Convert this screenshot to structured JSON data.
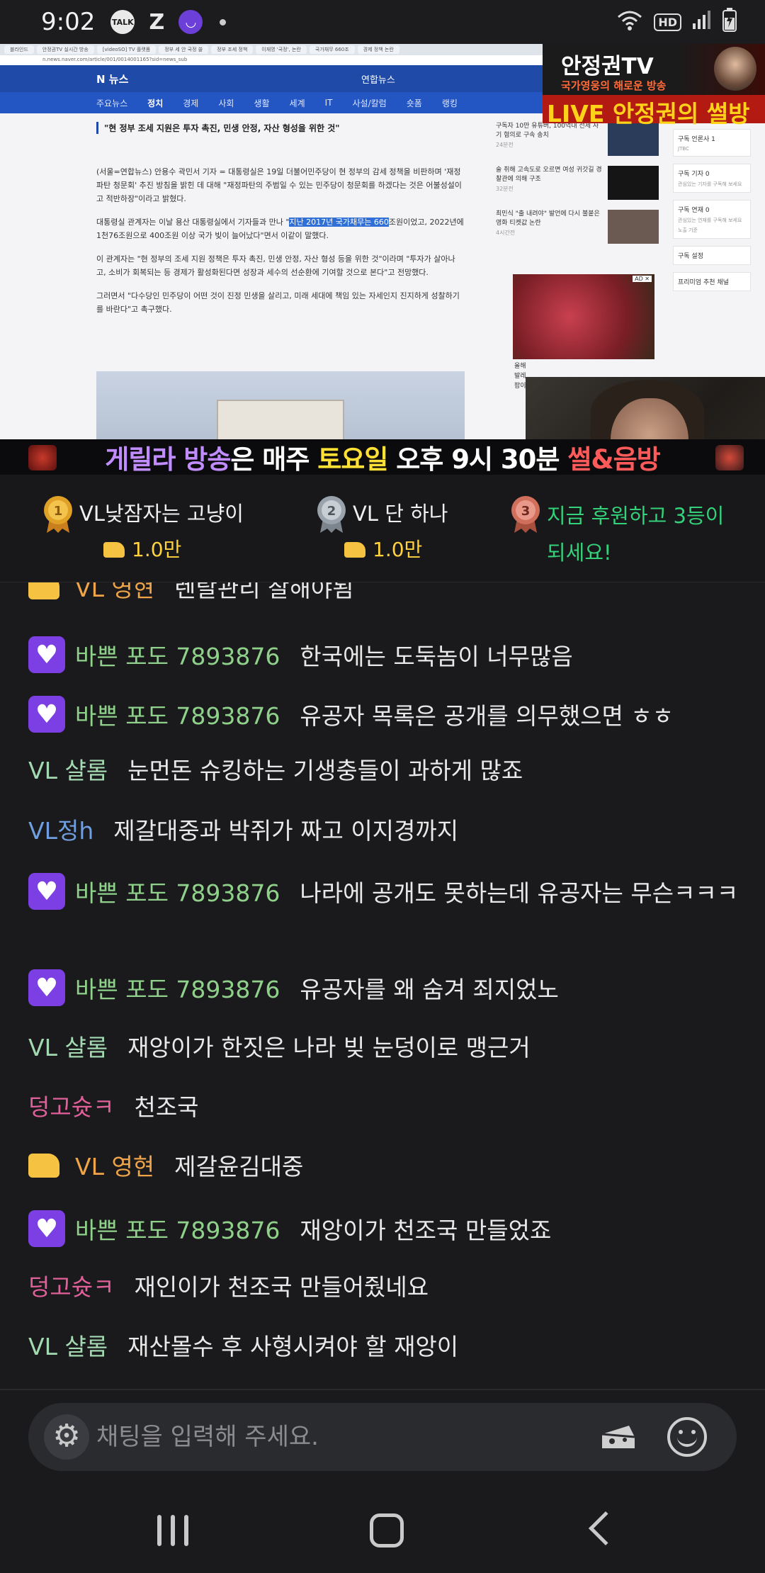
{
  "status_bar": {
    "time": "9:02",
    "icons": [
      "talk-icon",
      "z-icon",
      "channel-icon",
      "dot-icon",
      "wifi-icon",
      "hd-icon",
      "signal-icon",
      "battery-icon"
    ],
    "talk": "TALK",
    "hd": "HD"
  },
  "stream_overlay": {
    "channel_title": "안정권TV",
    "channel_sub": "국가영웅의 해로운 방송",
    "live_label": "LIVE 안정권의 썰방",
    "banner": {
      "part1": "게릴라 방송",
      "part2": "은 매주 ",
      "part3": "토요일",
      "part4": " 오후 9시 30분 ",
      "part5": "썰&음방"
    }
  },
  "browser": {
    "tabs": [
      "블라인드",
      "안정권TV 실시간 방송",
      "[videoSO] TV 플랫폼",
      "정부 세 안 국정 쏠",
      "정부 조세 정책",
      "이재명 '국정', 논란",
      "국가채무 660조",
      "경제 정책 논란"
    ],
    "url": "n.news.naver.com/article/001/0014001165?sid=news_sub"
  },
  "news": {
    "logo": "N 뉴스",
    "source": "연합뉴스",
    "nav": [
      "주요뉴스",
      "정치",
      "경제",
      "사회",
      "생활",
      "세계",
      "IT",
      "사설/칼럼",
      "숏폼",
      "랭킹"
    ],
    "headline": "\"현 정부 조세 지원은 투자 촉진, 민생 안정, 자산 형성을 위한 것\"",
    "p1": "(서울=연합뉴스) 안용수 곽민서 기자 = 대통령실은 19일 더불어민주당이 현 정부의 감세 정책을 비판하며 '재정파탄 청문회' 추진 방침을 밝힌 데 대해 \"재정파탄의 주범일 수 있는 민주당이 청문회를 하겠다는 것은 어불성설이고 적반하장\"이라고 밝혔다.",
    "p2_before": "대통령실 관계자는 이날 용산 대통령실에서 기자들과 만나 \"",
    "p2_highlight": "지난 2017년 국가채무는 660",
    "p2_after": "조원이었고, 2022년에 1천76조원으로 400조원 이상 국가 빚이 늘어났다\"면서 이같이 말했다.",
    "p3": "이 관계자는 \"현 정부의 조세 지원 정책은 투자 촉진, 민생 안정, 자산 형성 등을 위한 것\"이라며 \"투자가 살아나고, 소비가 회복되는 등 경제가 활성화된다면 성장과 세수의 선순환에 기여할 것으로 본다\"고 전망했다.",
    "p4": "그러면서 \"다수당인 민주당이 어떤 것이 진정 민생을 살리고, 미래 세대에 책임 있는 자세인지 진지하게 성찰하기를 바란다\"고 촉구했다.",
    "side_items": [
      {
        "text": "구독자 10만 유튜버, 100억대 전세 사기 혐의로 구속 송치",
        "time": "24분전"
      },
      {
        "text": "술 취해 고속도로 오르면 여성 귀갓길 경찰관에 의해 구조",
        "time": "32분전"
      },
      {
        "text": "최민식 \"출 내려야\" 발언에 다시 불붙은 영화 티켓값 논란",
        "time": "4시간전"
      }
    ],
    "ad_tag": "AD ✕",
    "ad_caption_1": "올해",
    "ad_caption_2": "발레",
    "ad_caption_3": "팜이",
    "subscribe": [
      {
        "title": "구독 언론사 1",
        "sub": "JTBC"
      },
      {
        "title": "구독 기자 0",
        "sub": "관심있는 기자를 구독해 보세요"
      },
      {
        "title": "구독 연재 0",
        "sub": "관심있는 연재를 구독해 보세요"
      },
      {
        "title": "구독 설정",
        "sub": ""
      },
      {
        "title": "프리미엄 추천 채널",
        "sub": ""
      }
    ],
    "noti": "노출 기준"
  },
  "ranking": [
    {
      "rank": "1",
      "name": "VL낮잠자는 고냥이",
      "amount": "1.0만",
      "medal_color": "#e0a226"
    },
    {
      "rank": "2",
      "name": "VL 단 하나",
      "amount": "1.0만",
      "medal_color": "#9aa3ab"
    },
    {
      "rank": "3",
      "name_line1": "지금 후원하고 3등이",
      "name_line2": "되세요!",
      "medal_color": "#d0705c"
    }
  ],
  "chat": [
    {
      "nick": "VL 영현",
      "nick_color": "#f0a449",
      "badge": "cheese",
      "text": "렌탈관리 잘해야됨"
    },
    {
      "nick": "바쁜 포도 7893876",
      "nick_color": "#8fd08a",
      "badge": "sub",
      "text": "한국에는 도둑놈이 너무많음"
    },
    {
      "nick": "바쁜 포도 7893876",
      "nick_color": "#8fd08a",
      "badge": "sub",
      "text": "유공자 목록은 공개를 의무했으면 ㅎㅎ"
    },
    {
      "nick": "VL 샬롬",
      "nick_color": "#a3d9b1",
      "badge": "",
      "text": "눈먼돈 슈킹하는 기생충들이 과하게 많죠"
    },
    {
      "nick": "VL정h",
      "nick_color": "#6f9fe0",
      "badge": "",
      "text": "제갈대중과 박쥐가 짜고 이지경까지"
    },
    {
      "nick": "바쁜 포도 7893876",
      "nick_color": "#8fd08a",
      "badge": "sub",
      "text": "나라에 공개도 못하는데 유공자는 무슨ㅋㅋㅋ"
    },
    {
      "nick": "바쁜 포도 7893876",
      "nick_color": "#8fd08a",
      "badge": "sub",
      "text": "유공자를 왜 숨겨 죄지었노"
    },
    {
      "nick": "VL 샬롬",
      "nick_color": "#a3d9b1",
      "badge": "",
      "text": "재앙이가 한짓은 나라 빚 눈덩이로 맹근거"
    },
    {
      "nick": "덩고슛ㅋ",
      "nick_color": "#e0609a",
      "badge": "",
      "text": "천조국"
    },
    {
      "nick": "VL 영현",
      "nick_color": "#f0a449",
      "badge": "cheese",
      "text": "제갈윤김대중"
    },
    {
      "nick": "바쁜 포도 7893876",
      "nick_color": "#8fd08a",
      "badge": "sub",
      "text": "재앙이가 천조국 만들었죠"
    },
    {
      "nick": "덩고슛ㅋ",
      "nick_color": "#e0609a",
      "badge": "",
      "text": "재인이가 천조국 만들어줬네요"
    },
    {
      "nick": "VL 샬롬",
      "nick_color": "#a3d9b1",
      "badge": "",
      "text": "재산몰수 후 사형시켜야 할 재앙이"
    }
  ],
  "input": {
    "placeholder": "채팅을 입력해 주세요.",
    "value": ""
  },
  "colors": {
    "background": "#1a1a1c",
    "accent_purple": "#7b3fe4",
    "cheese": "#f5c242",
    "rank_text": "#33d17a"
  }
}
